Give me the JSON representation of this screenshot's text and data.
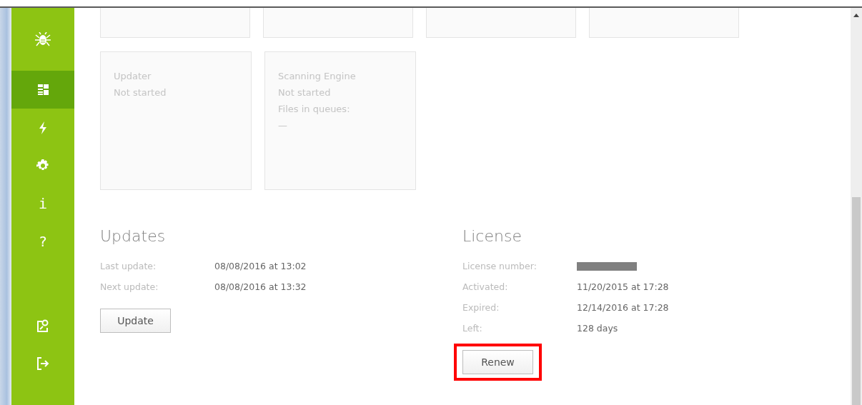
{
  "sidebar": {
    "top_items": [
      {
        "kind": "icon",
        "selected": true
      },
      {
        "kind": "icon",
        "selected": false
      },
      {
        "kind": "icon",
        "selected": false
      },
      {
        "kind": "glyph",
        "glyph": "i",
        "selected": false
      },
      {
        "kind": "glyph",
        "glyph": "?",
        "selected": false
      }
    ],
    "bottom_items": [
      {
        "kind": "icon",
        "selected": false
      },
      {
        "kind": "icon",
        "selected": false
      }
    ]
  },
  "top_cards": [
    {
      "kind": "blank"
    },
    {
      "kind": "blank"
    },
    {
      "kind": "blank"
    },
    {
      "kind": "blank"
    }
  ],
  "cards": [
    {
      "title": "Updater",
      "lines": [
        "Not started"
      ]
    },
    {
      "title": "Scanning Engine",
      "lines": [
        "Not started",
        "Files in queues:",
        "—"
      ]
    }
  ],
  "updates": {
    "title": "Updates",
    "rows": [
      {
        "label": "Last update:",
        "value": "08/08/2016 at 13:02",
        "kind": "text"
      },
      {
        "label": "Next update:",
        "value": "08/08/2016 at 13:32",
        "kind": "text"
      }
    ],
    "button": {
      "label": "Update",
      "highlighted": false
    }
  },
  "license": {
    "title": "License",
    "rows": [
      {
        "label": "License number:",
        "kind": "redacted"
      },
      {
        "label": "Activated:",
        "value": "11/20/2015 at 17:28",
        "kind": "text"
      },
      {
        "label": "Expired:",
        "value": "12/14/2016 at 17:28",
        "kind": "text"
      },
      {
        "label": "Left:",
        "value": "128 days",
        "kind": "text"
      }
    ],
    "button": {
      "label": "Renew",
      "highlighted": true
    }
  }
}
